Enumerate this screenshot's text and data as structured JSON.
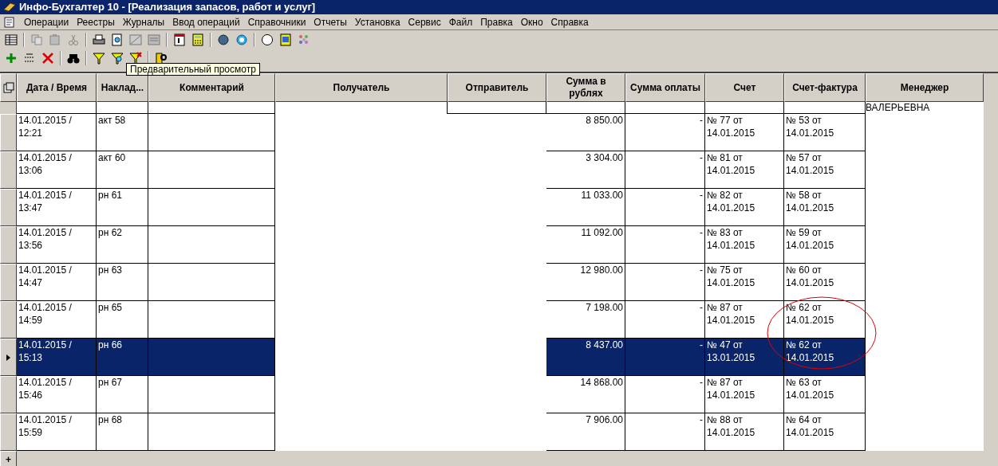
{
  "window": {
    "title": "Инфо-Бухгалтер 10 - [Реализация запасов, работ и услуг]"
  },
  "menu": [
    "Операции",
    "Реестры",
    "Журналы",
    "Ввод операций",
    "Справочники",
    "Отчеты",
    "Установка",
    "Сервис",
    "Файл",
    "Правка",
    "Окно",
    "Справка"
  ],
  "tooltip": "Предварительный просмотр",
  "table": {
    "columns": [
      "Дата / Время",
      "Наклад...",
      "Комментарий",
      "Получатель",
      "Отправитель",
      "Сумма в рублях",
      "Сумма оплаты",
      "Счет",
      "Счет-фактура",
      "Менеджер"
    ],
    "top_row": {
      "manager": "ВАЛЕРЬЕВНА"
    },
    "rows": [
      {
        "date": "14.01.2015 / 12:21",
        "invoice": "акт 58",
        "amount": "8 850.00",
        "paid": "-",
        "bill": "№ 77 от 14.01.2015",
        "tax_invoice": "№ 53 от 14.01.2015",
        "selected": false
      },
      {
        "date": "14.01.2015 / 13:06",
        "invoice": "акт 60",
        "amount": "3 304.00",
        "paid": "-",
        "bill": "№ 81 от 14.01.2015",
        "tax_invoice": "№ 57 от 14.01.2015",
        "selected": false
      },
      {
        "date": "14.01.2015 / 13:47",
        "invoice": "рн 61",
        "amount": "11 033.00",
        "paid": "-",
        "bill": "№ 82 от 14.01.2015",
        "tax_invoice": "№ 58 от 14.01.2015",
        "selected": false
      },
      {
        "date": "14.01.2015 / 13:56",
        "invoice": "рн 62",
        "amount": "11 092.00",
        "paid": "-",
        "bill": "№ 83 от 14.01.2015",
        "tax_invoice": "№ 59 от 14.01.2015",
        "selected": false
      },
      {
        "date": "14.01.2015 / 14:47",
        "invoice": "рн 63",
        "amount": "12 980.00",
        "paid": "-",
        "bill": "№ 75 от 14.01.2015",
        "tax_invoice": "№ 60 от 14.01.2015",
        "selected": false
      },
      {
        "date": "14.01.2015 / 14:59",
        "invoice": "рн 65",
        "amount": "7 198.00",
        "paid": "-",
        "bill": "№ 87 от 14.01.2015",
        "tax_invoice": "№ 62 от 14.01.2015",
        "selected": false
      },
      {
        "date": "14.01.2015 / 15:13",
        "invoice": "рн 66",
        "amount": "8 437.00",
        "paid": "-",
        "bill": "№ 47 от 13.01.2015",
        "tax_invoice": "№ 62 от 14.01.2015",
        "selected": true
      },
      {
        "date": "14.01.2015 / 15:46",
        "invoice": "рн 67",
        "amount": "14 868.00",
        "paid": "-",
        "bill": "№ 87 от 14.01.2015",
        "tax_invoice": "№ 63 от 14.01.2015",
        "selected": false
      },
      {
        "date": "14.01.2015 / 15:59",
        "invoice": "рн 68",
        "amount": "7 906.00",
        "paid": "-",
        "bill": "№ 88 от 14.01.2015",
        "tax_invoice": "№ 64 от 14.01.2015",
        "selected": false
      }
    ],
    "new_row_marker": "+"
  }
}
